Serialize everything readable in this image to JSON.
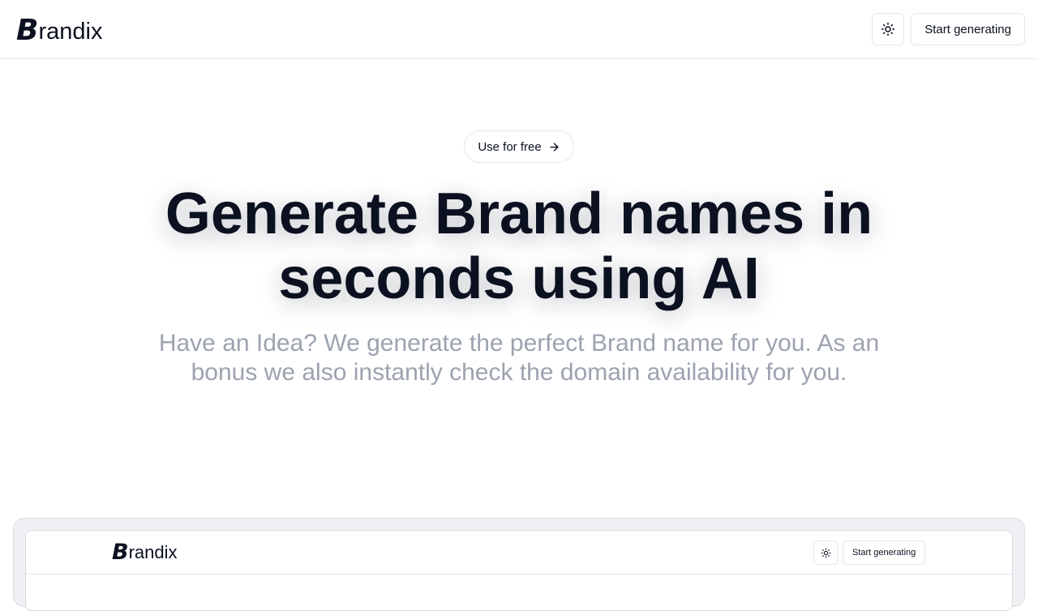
{
  "header": {
    "logo_mark": "B",
    "logo_text": "randix",
    "theme_toggle_icon": "sun-icon",
    "cta_label": "Start generating"
  },
  "hero": {
    "pill_label": "Use for free",
    "pill_icon": "arrow-right-icon",
    "headline_line1": "Generate Brand names in",
    "headline_line2": "seconds using AI",
    "subhead_line1": "Have an Idea? We generate the perfect Brand name for you. As an",
    "subhead_line2": "bonus we also instantly check the domain availability for you."
  },
  "preview": {
    "logo_mark": "B",
    "logo_text": "randix",
    "theme_toggle_icon": "sun-icon",
    "cta_label": "Start generating"
  },
  "colors": {
    "text": "#0b1120",
    "muted": "#9ca3af",
    "border": "#e5e7eb",
    "frame_bg": "#eef0f3"
  }
}
